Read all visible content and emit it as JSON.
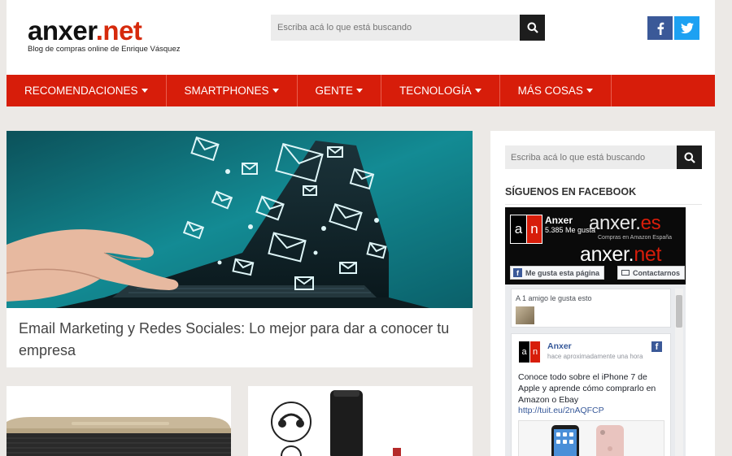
{
  "header": {
    "logo_main": "anxer",
    "logo_dot": ".",
    "logo_tld": "net",
    "logo_tagline": "Blog de compras online de Enrique Vásquez",
    "search_placeholder": "Escriba acá lo que está buscando",
    "social": [
      "facebook-icon",
      "twitter-icon"
    ]
  },
  "nav": {
    "items": [
      {
        "label": "RECOMENDACIONES"
      },
      {
        "label": "SMARTPHONES"
      },
      {
        "label": "GENTE"
      },
      {
        "label": "TECNOLOGÍA"
      },
      {
        "label": "MÁS COSAS"
      }
    ]
  },
  "main": {
    "featured_title": "Email Marketing y Redes Sociales: Lo mejor para dar a conocer tu empresa"
  },
  "sidebar": {
    "search_placeholder": "Escriba acá lo que está buscando",
    "heading": "SÍGUENOS EN FACEBOOK",
    "fb": {
      "avatar_left": "a",
      "avatar_right": "n",
      "page_name": "Anxer",
      "likes": "5.385 Me gusta",
      "brand_es_main": "anxer.",
      "brand_es_tld": "es",
      "brand_es_sub": "Compras en Amazon España",
      "brand_net_main": "anxer.",
      "brand_net_tld": "net",
      "like_button": "Me gusta esta página",
      "contact_button": "Contactarnos",
      "friends_text": "A 1 amigo le gusta esto",
      "post_name": "Anxer",
      "post_time": "hace aproximadamente una hora",
      "post_text": "Conoce todo sobre el iPhone 7 de Apple y aprende cómo comprarlo en Amazon o Ebay",
      "post_link": "http://tuit.eu/2nAQFCP"
    }
  },
  "colors": {
    "brand_red": "#d71d0a",
    "facebook": "#3b5998",
    "twitter": "#1da1f2"
  }
}
